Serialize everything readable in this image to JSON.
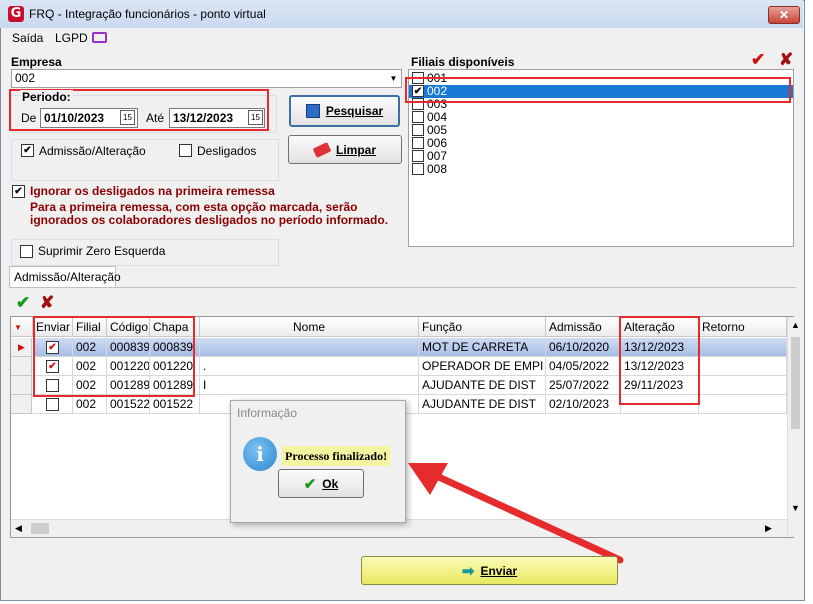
{
  "window": {
    "title": "FRQ - Integração funcionários - ponto virtual",
    "close_label": "✕"
  },
  "menu": {
    "items": [
      "Saída",
      "LGPD"
    ]
  },
  "empresa": {
    "label": "Empresa",
    "value": "002"
  },
  "periodo": {
    "label": "Periodo:",
    "de_label": "De",
    "de_value": "01/10/2023",
    "ate_label": "Até",
    "ate_value": "13/12/2023",
    "cal_label": "15"
  },
  "buttons": {
    "pesquisar": "Pesquisar",
    "limpar": "Limpar",
    "enviar": "Enviar",
    "ok": "Ok"
  },
  "options": {
    "admissao": {
      "label": "Admissão/Alteração",
      "checked": true
    },
    "desligados": {
      "label": "Desligados",
      "checked": false
    },
    "ignorar": {
      "label": "Ignorar os desligados na primeira remessa",
      "checked": true
    },
    "ignorar_note_1": "Para a primeira remessa, com esta opção marcada, serão",
    "ignorar_note_2": "ignorados os colaboradores desligados no período informado.",
    "suprimir": {
      "label": "Suprimir Zero Esquerda",
      "checked": false
    }
  },
  "filiais": {
    "label": "Filiais disponíveis",
    "items": [
      {
        "code": "001",
        "checked": false,
        "selected": false
      },
      {
        "code": "002",
        "checked": true,
        "selected": true
      },
      {
        "code": "003",
        "checked": false,
        "selected": false
      },
      {
        "code": "004",
        "checked": false,
        "selected": false
      },
      {
        "code": "005",
        "checked": false,
        "selected": false
      },
      {
        "code": "006",
        "checked": false,
        "selected": false
      },
      {
        "code": "007",
        "checked": false,
        "selected": false
      },
      {
        "code": "008",
        "checked": false,
        "selected": false
      }
    ]
  },
  "tab": {
    "label": "Admissão/Alteração"
  },
  "grid": {
    "columns": [
      "Enviar",
      "Filial",
      "Código",
      "Chapa",
      "Nome",
      "Função",
      "Admissão",
      "Alteração",
      "Retorno"
    ],
    "rows": [
      {
        "enviar": true,
        "filial": "002",
        "codigo": "000839",
        "chapa": "000839",
        "nome": "",
        "funcao": "MOT DE CARRETA",
        "admissao": "06/10/2020",
        "alteracao": "13/12/2023",
        "retorno": ""
      },
      {
        "enviar": true,
        "filial": "002",
        "codigo": "001220",
        "chapa": "001220",
        "nome": ".",
        "funcao": "OPERADOR DE EMPI",
        "admissao": "04/05/2022",
        "alteracao": "13/12/2023",
        "retorno": ""
      },
      {
        "enviar": false,
        "filial": "002",
        "codigo": "001289",
        "chapa": "001289",
        "nome": "I",
        "funcao": "AJUDANTE DE DIST",
        "admissao": "25/07/2022",
        "alteracao": "29/11/2023",
        "retorno": ""
      },
      {
        "enviar": false,
        "filial": "002",
        "codigo": "001522",
        "chapa": "001522",
        "nome": "",
        "funcao": "AJUDANTE DE DIST",
        "admissao": "02/10/2023",
        "alteracao": "",
        "retorno": ""
      }
    ]
  },
  "dialog": {
    "title": "Informação",
    "message": "Processo finalizado!",
    "icon": "info-icon"
  },
  "colors": {
    "accent_red": "#e52b2b",
    "selection_blue": "#1a78d6",
    "enviar_yellow": "#f0f07a"
  }
}
